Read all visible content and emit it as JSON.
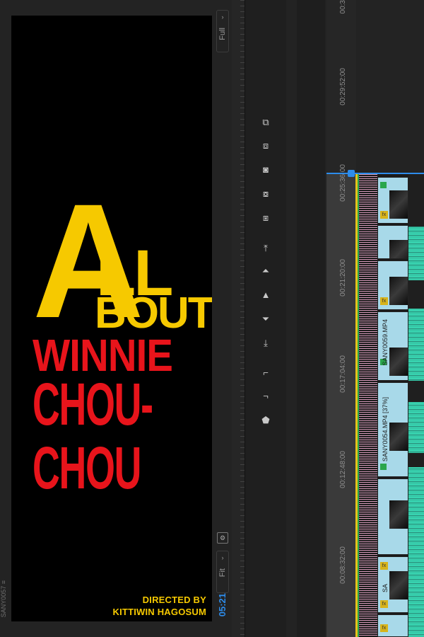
{
  "program_monitor": {
    "title_card": {
      "line_a": "A",
      "line_ll": "LL",
      "line_bout": "BOUT",
      "line_winnie": "WINNIE",
      "line_chou": "CHOU-CHOU",
      "credit_line1": "DIRECTED BY",
      "credit_line2": "KITTIWIN  HAGOSUM"
    },
    "zoom_select": "Full",
    "fit_select": "Fit",
    "timecode": "05:21",
    "side_label": "SANY0057 ≡"
  },
  "tools": [
    {
      "name": "lift-icon",
      "glyph": "⧉"
    },
    {
      "name": "extract-icon",
      "glyph": "⧈"
    },
    {
      "name": "export-frame-icon",
      "glyph": "◙"
    },
    {
      "name": "insert-icon",
      "glyph": "⧇"
    },
    {
      "name": "overwrite-icon",
      "glyph": "⧆"
    },
    {
      "name": "go-to-in-icon",
      "glyph": "⤒"
    },
    {
      "name": "step-back-icon",
      "glyph": "⏶"
    },
    {
      "name": "play-icon",
      "glyph": "▲"
    },
    {
      "name": "step-forward-icon",
      "glyph": "⏷"
    },
    {
      "name": "go-to-out-icon",
      "glyph": "⤓"
    },
    {
      "name": "mark-in-icon",
      "glyph": "⌐"
    },
    {
      "name": "mark-out-icon",
      "glyph": "¬"
    },
    {
      "name": "add-marker-icon",
      "glyph": "⬟"
    }
  ],
  "timeline": {
    "ruler_labels": [
      "00:3",
      "00:29:52:00",
      "00:25:36:00",
      "00:21:20:00",
      "00:17:04:00",
      "00:12:48:00",
      "00:08:32:00"
    ],
    "clips": [
      {
        "label": ""
      },
      {
        "label": ""
      },
      {
        "label": ""
      },
      {
        "label": "SANY0059.MP4"
      },
      {
        "label": "SANY0054.MP4 [37%]"
      },
      {
        "label": ""
      },
      {
        "label": "SA"
      },
      {
        "label": ""
      }
    ]
  }
}
